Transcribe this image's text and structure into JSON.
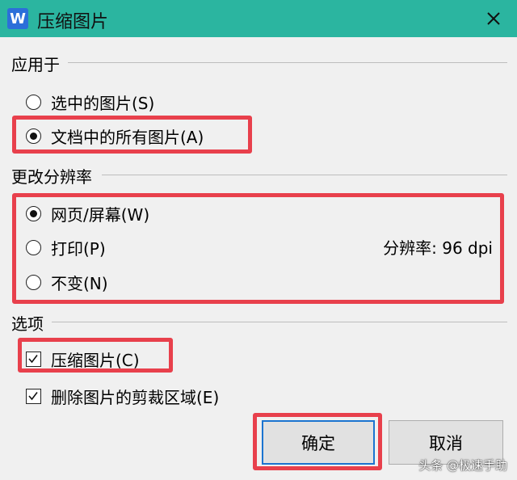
{
  "window": {
    "title": "压缩图片",
    "app_icon_letter": "W"
  },
  "apply_to": {
    "label": "应用于",
    "options": [
      {
        "label": "选中的图片(S)",
        "checked": false
      },
      {
        "label": "文档中的所有图片(A)",
        "checked": true
      }
    ]
  },
  "resolution": {
    "label": "更改分辨率",
    "options": [
      {
        "label": "网页/屏幕(W)",
        "checked": true
      },
      {
        "label": "打印(P)",
        "checked": false
      },
      {
        "label": "不变(N)",
        "checked": false
      }
    ],
    "value_text": "分辨率: 96 dpi"
  },
  "options": {
    "label": "选项",
    "items": [
      {
        "label": "压缩图片(C)",
        "checked": true
      },
      {
        "label": "删除图片的剪裁区域(E)",
        "checked": true
      }
    ]
  },
  "buttons": {
    "ok": "确定",
    "cancel": "取消"
  },
  "watermark": "头条 @极速手助",
  "colors": {
    "titlebar": "#2bb5a0",
    "highlight": "#e8404c",
    "focus": "#1b74d0"
  }
}
